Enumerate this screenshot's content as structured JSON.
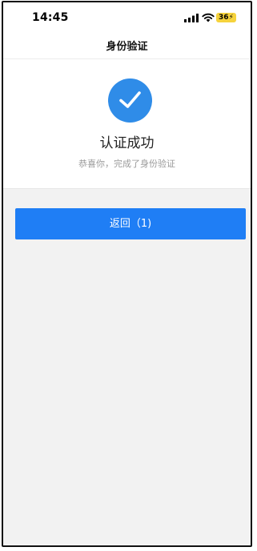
{
  "status_bar": {
    "time": "14:45",
    "battery": "36"
  },
  "nav": {
    "title": "身份验证"
  },
  "result": {
    "title": "认证成功",
    "subtitle": "恭喜你，完成了身份验证",
    "icon": "check-circle-icon",
    "icon_color": "#2f8ce8"
  },
  "actions": {
    "back_label": "返回（1)",
    "button_color": "#1f7ef5"
  }
}
